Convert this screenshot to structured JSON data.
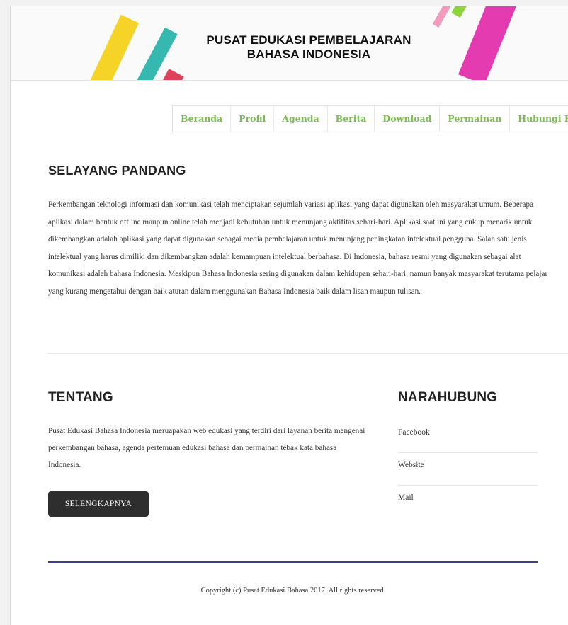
{
  "header": {
    "title_line1": "PUSAT EDUKASI PEMBELAJARAN",
    "title_line2": "BAHASA INDONESIA",
    "stripe_colors": [
      "#f5d327",
      "#35b8b0",
      "#e0415a",
      "#f29bbd",
      "#8fd43f",
      "#e53bb1"
    ]
  },
  "nav": {
    "items": [
      "Beranda",
      "Profil",
      "Agenda",
      "Berita",
      "Download",
      "Permainan",
      "Hubungi Kami"
    ],
    "color": "#7bbd4f"
  },
  "intro": {
    "title": "SELAYANG PANDANG",
    "text": "Perkembangan teknologi informasi dan komunikasi telah menciptakan sejumlah variasi aplikasi yang dapat digunakan oleh masyarakat umum. Beberapa aplikasi dalam bentuk offline maupun online telah menjadi kebutuhan untuk menunjang aktifitas sehari-hari. Aplikasi saat ini yang cukup menarik untuk dikembangkan adalah aplikasi yang dapat digunakan sebagai media pembelajaran untuk menunjang peningkatan intelektual pengguna. Salah satu jenis intelektual yang harus dimiliki dan dikembangkan adalah kemampuan intelektual berbahasa. Di Indonesia, bahasa resmi yang digunakan sebagai alat komunikasi adalah bahasa Indonesia. Meskipun Bahasa Indonesia sering digunakan dalam kehidupan sehari-hari, namun banyak masyarakat terutama pelajar yang kurang mengetahui dengan baik aturan dalam menggunakan Bahasa Indonesia baik dalam lisan maupun tulisan."
  },
  "about": {
    "title": "TENTANG",
    "text": "Pusat Edukasi Bahasa Indonesia meruapakan web edukasi yang terdiri dari layanan berita mengenai perkembangan bahasa, agenda pertemuan edukasi bahasa dan permainan tebak kata bahasa Indonesia.",
    "button_label": "SELENGKAPNYA"
  },
  "contact": {
    "title": "NARAHUBUNG",
    "items": [
      "Facebook",
      "Website",
      "Mail"
    ]
  },
  "footer": {
    "copyright": "Copyright (c) Pusat Edukasi Bahasa 2017. All rights reserved.",
    "line_color": "#3a3f8f"
  }
}
